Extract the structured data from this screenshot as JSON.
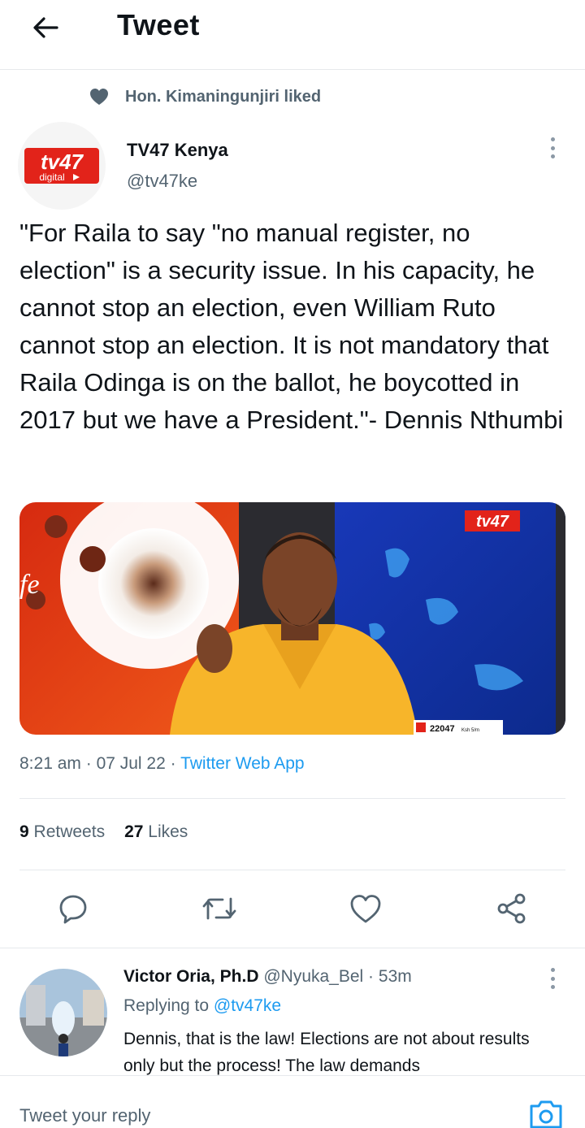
{
  "header": {
    "title": "Tweet",
    "back_icon": "arrow-left-icon"
  },
  "social_context": {
    "text": "Hon. Kimaningunjiri liked",
    "icon": "heart-icon"
  },
  "author": {
    "name": "TV47 Kenya",
    "handle": "@tv47ke",
    "avatar_logo_text": "tv47",
    "avatar_logo_sub": "digital"
  },
  "tweet": {
    "text": "\"For Raila to say \"no manual register, no election\" is a security issue. In his capacity, he cannot stop an election, even William Ruto cannot stop an election. It is not mandatory that Raila Odinga is on the ballot, he boycotted in 2017 but we have a President.\"- Dennis Nthumbi",
    "media": {
      "watermark": "tv47",
      "ticker_value": "22047",
      "ticker_unit": "Ksh 5/m"
    }
  },
  "meta": {
    "time": "8:21 am",
    "date": "07 Jul 22",
    "source": "Twitter Web App",
    "separator": " · "
  },
  "stats": {
    "retweets_count": "9",
    "retweets_label": "Retweets",
    "likes_count": "27",
    "likes_label": "Likes"
  },
  "actions": {
    "icons": [
      "reply-icon",
      "retweet-icon",
      "like-icon",
      "share-icon"
    ]
  },
  "reply": {
    "name": "Victor Oria, Ph.D",
    "handle": "@Nyuka_Bel",
    "time": "53m",
    "replying_label": "Replying to",
    "replying_handle": "@tv47ke",
    "text": "Dennis, that is the law! Elections are not about results only but the process! The law demands"
  },
  "compose": {
    "placeholder": "Tweet your reply",
    "camera_icon": "camera-icon"
  },
  "colors": {
    "accent": "#1d9bf0",
    "secondary_text": "#536471",
    "brand_red": "#e2231a",
    "border": "#e6e9ec"
  }
}
